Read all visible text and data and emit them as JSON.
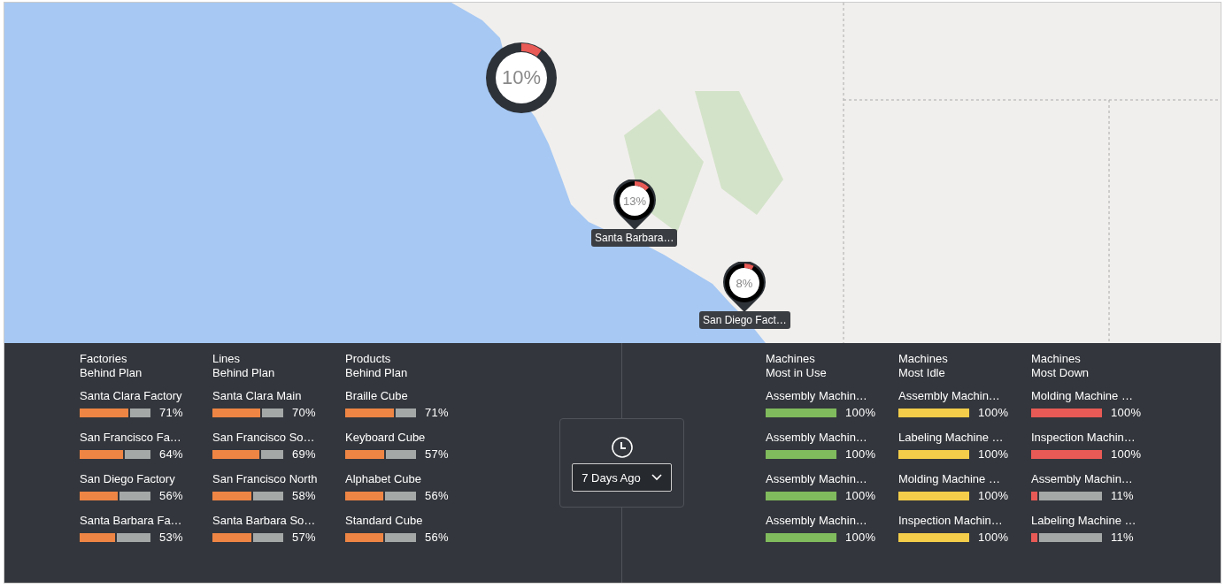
{
  "map": {
    "markers": [
      {
        "kind": "ring",
        "value": "10%",
        "level": 0.1
      },
      {
        "kind": "pin",
        "value": "13%",
        "level": 0.13,
        "label": "Santa Barbara…"
      },
      {
        "kind": "pin",
        "value": "8%",
        "level": 0.08,
        "label": "San Diego Fact…"
      }
    ]
  },
  "panel": {
    "columns": [
      {
        "title": "Factories",
        "subtitle": "Behind Plan",
        "color": "#ee8544",
        "items": [
          {
            "name": "Santa Clara Factory",
            "level": 0.71,
            "value": "71%"
          },
          {
            "name": "San Francisco Fa…",
            "level": 0.64,
            "value": "64%"
          },
          {
            "name": "San Diego Factory",
            "level": 0.56,
            "value": "56%"
          },
          {
            "name": "Santa Barbara Fa…",
            "level": 0.53,
            "value": "53%"
          }
        ]
      },
      {
        "title": "Lines",
        "subtitle": "Behind Plan",
        "color": "#ee8544",
        "items": [
          {
            "name": "Santa Clara Main",
            "level": 0.7,
            "value": "70%"
          },
          {
            "name": "San Francisco So…",
            "level": 0.69,
            "value": "69%"
          },
          {
            "name": "San Francisco North",
            "level": 0.58,
            "value": "58%"
          },
          {
            "name": "Santa Barbara So…",
            "level": 0.57,
            "value": "57%"
          }
        ]
      },
      {
        "title": "Products",
        "subtitle": "Behind Plan",
        "color": "#ee8544",
        "items": [
          {
            "name": "Braille Cube",
            "level": 0.71,
            "value": "71%"
          },
          {
            "name": "Keyboard Cube",
            "level": 0.57,
            "value": "57%"
          },
          {
            "name": "Alphabet Cube",
            "level": 0.56,
            "value": "56%"
          },
          {
            "name": "Standard Cube",
            "level": 0.56,
            "value": "56%"
          }
        ]
      },
      {
        "title": "Machines",
        "subtitle": "Most in Use",
        "color": "#80bb5d",
        "items": [
          {
            "name": "Assembly Machin…",
            "level": 1,
            "value": "100%"
          },
          {
            "name": "Assembly Machin…",
            "level": 1,
            "value": "100%"
          },
          {
            "name": "Assembly Machin…",
            "level": 1,
            "value": "100%"
          },
          {
            "name": "Assembly Machin…",
            "level": 1,
            "value": "100%"
          }
        ]
      },
      {
        "title": "Machines",
        "subtitle": "Most Idle",
        "color": "#f4cd4a",
        "items": [
          {
            "name": "Assembly Machin…",
            "level": 1,
            "value": "100%"
          },
          {
            "name": "Labeling Machine …",
            "level": 1,
            "value": "100%"
          },
          {
            "name": "Molding Machine …",
            "level": 1,
            "value": "100%"
          },
          {
            "name": "Inspection Machin…",
            "level": 1,
            "value": "100%"
          }
        ]
      },
      {
        "title": "Machines",
        "subtitle": "Most Down",
        "color": "#e85a55",
        "items": [
          {
            "name": "Molding Machine …",
            "level": 1,
            "value": "100%"
          },
          {
            "name": "Inspection Machin…",
            "level": 1,
            "value": "100%"
          },
          {
            "name": "Assembly Machin…",
            "level": 0.11,
            "value": "11%"
          },
          {
            "name": "Labeling Machine …",
            "level": 0.11,
            "value": "11%"
          }
        ]
      }
    ],
    "time_filter": {
      "value": "7 Days Ago"
    }
  }
}
